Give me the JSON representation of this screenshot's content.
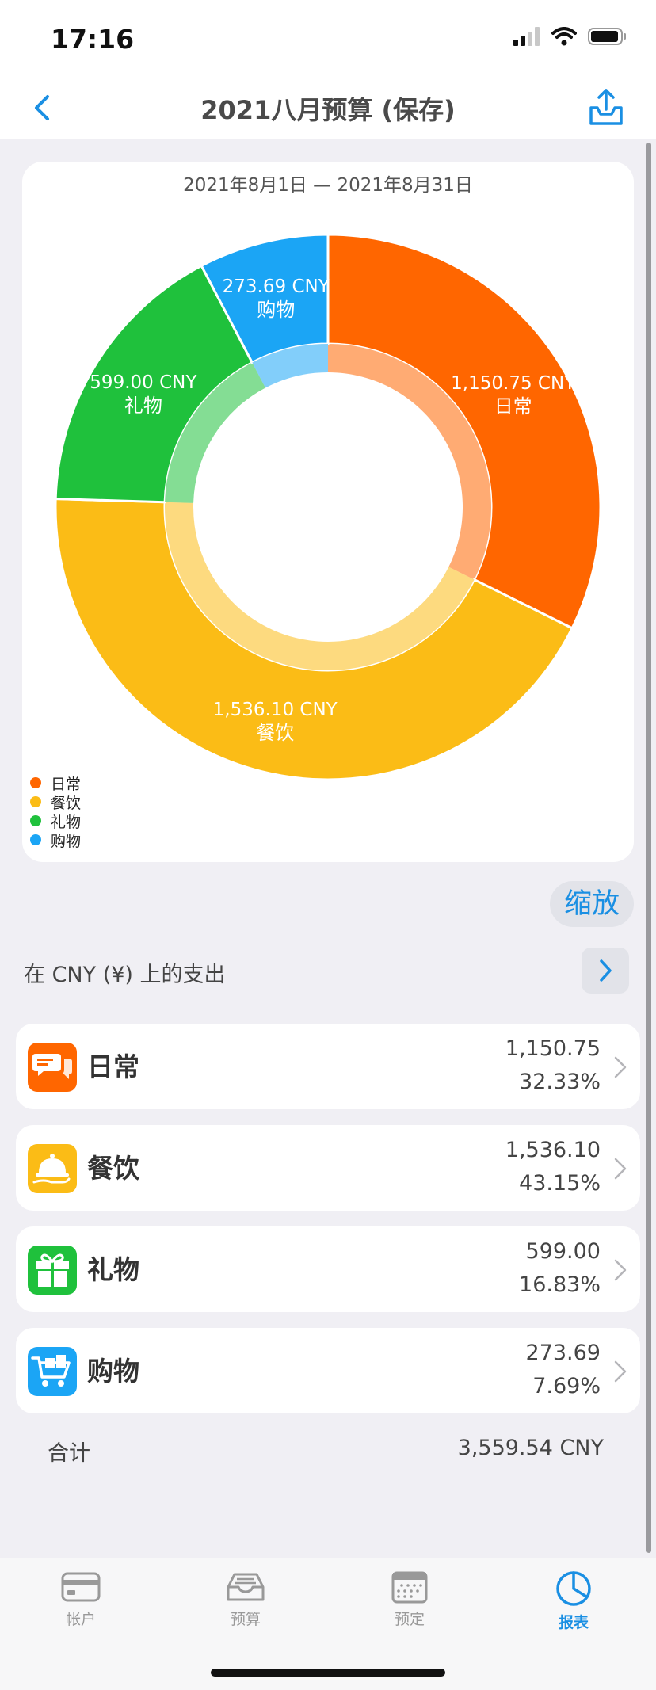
{
  "status_bar": {
    "time": "17:16"
  },
  "nav": {
    "title": "2021八月预算 (保存)"
  },
  "chart_data": {
    "type": "pie",
    "subtitle": "2021年8月1日 — 2021年8月31日",
    "currency": "CNY",
    "categories": [
      "日常",
      "餐饮",
      "礼物",
      "购物"
    ],
    "values": [
      1150.75,
      1536.1,
      599.0,
      273.69
    ],
    "value_labels": [
      "1,150.75 CNY",
      "1,536.10 CNY",
      "599.00 CNY",
      "273.69 CNY"
    ],
    "colors": [
      "#ff6600",
      "#fbbc16",
      "#1fc13c",
      "#1ba5f5"
    ],
    "legend": [
      "日常",
      "餐饮",
      "礼物",
      "购物"
    ],
    "legend_position": "bottom-left"
  },
  "zoom_label": "缩放",
  "spending": {
    "title": "在 CNY (¥) 上的支出"
  },
  "categories": [
    {
      "name": "日常",
      "amount": "1,150.75",
      "percent": "32.33%",
      "icon": "chat-bubbles-icon",
      "color": "#ff6600"
    },
    {
      "name": "餐饮",
      "amount": "1,536.10",
      "percent": "43.15%",
      "icon": "food-cloche-icon",
      "color": "#fbbc16"
    },
    {
      "name": "礼物",
      "amount": "599.00",
      "percent": "16.83%",
      "icon": "gift-icon",
      "color": "#1fc13c"
    },
    {
      "name": "购物",
      "amount": "273.69",
      "percent": "7.69%",
      "icon": "shopping-cart-icon",
      "color": "#1ba5f5"
    }
  ],
  "total": {
    "label": "合计",
    "value": "3,559.54 CNY"
  },
  "tabs": [
    {
      "label": "帐户",
      "icon": "card-icon",
      "active": false
    },
    {
      "label": "预算",
      "icon": "inbox-tray-icon",
      "active": false
    },
    {
      "label": "预定",
      "icon": "calendar-icon",
      "active": false
    },
    {
      "label": "报表",
      "icon": "pie-chart-icon",
      "active": true
    }
  ],
  "colors": {
    "accent": "#1a8fe3"
  }
}
